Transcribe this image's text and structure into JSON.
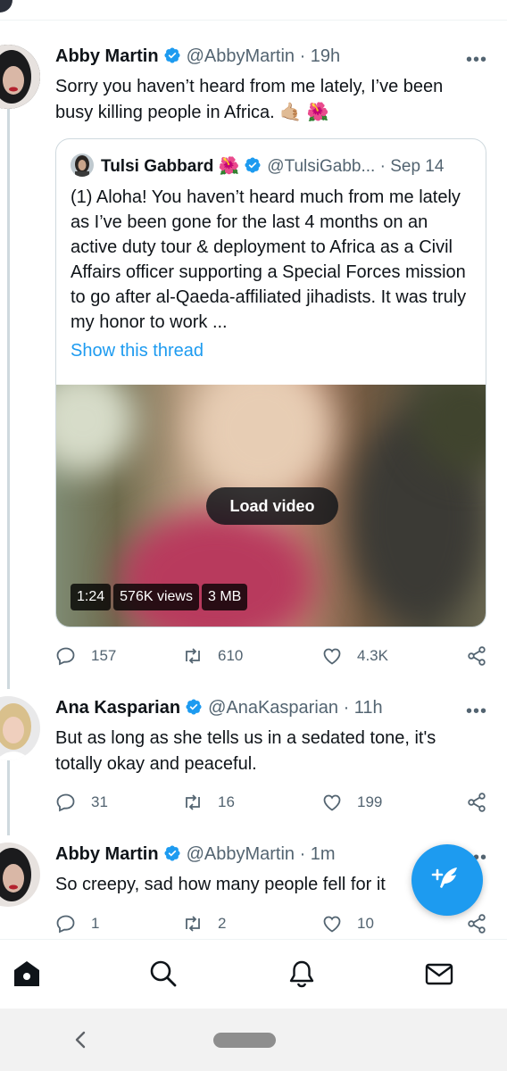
{
  "colors": {
    "accent": "#1d9bf0",
    "text": "#0f1419",
    "muted": "#536471",
    "border": "#cfd9de"
  },
  "tweets": [
    {
      "name": "Abby Martin",
      "handle": "@AbbyMartin",
      "time": "· 19h",
      "more": "•••",
      "text_line1": "Sorry you haven’t heard from me lately, I’ve been",
      "text_line2": "busy killing people in Africa.",
      "emoji": "🤙🏼 🌺",
      "replies": "157",
      "retweets": "610",
      "likes": "4.3K"
    },
    {
      "name": "Ana Kasparian",
      "handle": "@AnaKasparian",
      "time": "· 11h",
      "more": "•••",
      "text": "But as long as she tells us in a sedated tone, it's totally okay and peaceful.",
      "replies": "31",
      "retweets": "16",
      "likes": "199"
    },
    {
      "name": "Abby Martin",
      "handle": "@AbbyMartin",
      "time": "· 1m",
      "more": "•••",
      "text": "So creepy, sad how many people fell for it",
      "replies": "1",
      "retweets": "2",
      "likes": "10"
    }
  ],
  "quote": {
    "name": "Tulsi Gabbard",
    "name_emoji": "🌺",
    "handle": "@TulsiGabb...",
    "time": "· Sep 14",
    "text": "(1) Aloha! You haven’t heard much from me lately as I’ve been gone for the last 4 months on an active duty tour & deployment to Africa as a Civil Affairs officer supporting a Special Forces mission to go after al-Qaeda-affiliated jihadists. It was truly my honor to work ...",
    "show_thread": "Show this thread",
    "video": {
      "load_label": "Load video",
      "duration": "1:24",
      "views": "576K views",
      "size": "3 MB"
    }
  },
  "nav": {
    "icons": [
      "home-icon",
      "search-icon",
      "notifications-icon",
      "messages-icon"
    ]
  }
}
